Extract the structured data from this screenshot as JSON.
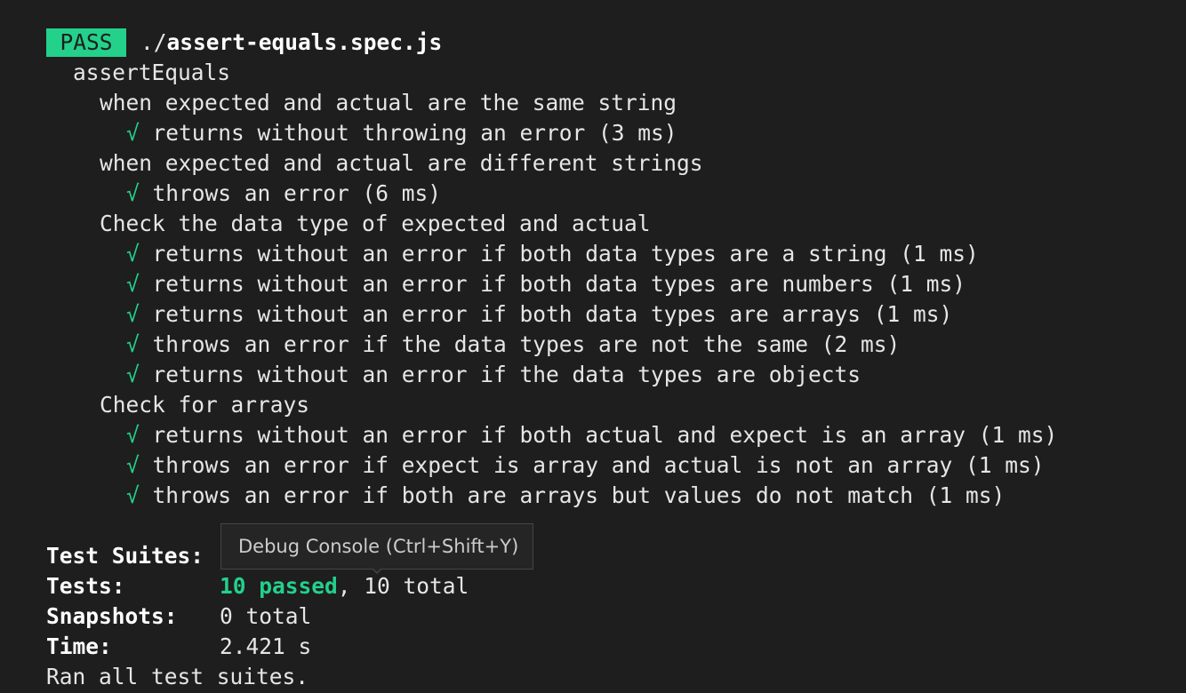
{
  "badge": {
    "label": "PASS"
  },
  "file": {
    "prefix": "./",
    "name": "assert-equals.spec.js"
  },
  "suite": {
    "name": "assertEquals"
  },
  "groups": [
    {
      "title": "when expected and actual are the same string",
      "tests": [
        {
          "check": "√",
          "text": "returns without throwing an error (3 ms)"
        }
      ]
    },
    {
      "title": "when expected and actual are different strings",
      "tests": [
        {
          "check": "√",
          "text": "throws an error (6 ms)"
        }
      ]
    },
    {
      "title": "Check the data type of expected and actual",
      "tests": [
        {
          "check": "√",
          "text": "returns without an error if both data types are a string (1 ms)"
        },
        {
          "check": "√",
          "text": "returns without an error if both data types are numbers (1 ms)"
        },
        {
          "check": "√",
          "text": "returns without an error if both data types are arrays (1 ms)"
        },
        {
          "check": "√",
          "text": "throws an error if the data types are not the same (2 ms)"
        },
        {
          "check": "√",
          "text": "returns without an error if the data types are objects"
        }
      ]
    },
    {
      "title": "Check for arrays",
      "tests": [
        {
          "check": "√",
          "text": "returns without an error if both actual and expect is an array (1 ms)"
        },
        {
          "check": "√",
          "text": "throws an error if expect is array and actual is not an array (1 ms)"
        },
        {
          "check": "√",
          "text": "throws an error if both are arrays but values do not match (1 ms)"
        }
      ]
    }
  ],
  "summary": {
    "suites_label": "Test Suites:",
    "tests_label": "Tests:",
    "tests_passed": "10 passed",
    "tests_sep": ",",
    "tests_total": "10 total",
    "snapshots_label": "Snapshots:",
    "snapshots_value": "0 total",
    "time_label": "Time:",
    "time_value": "2.421 s",
    "footer": "Ran all test suites."
  },
  "tooltip": {
    "text": "Debug Console (Ctrl+Shift+Y)"
  },
  "colors": {
    "background": "#1e1e1e",
    "pass_green": "#23d18b",
    "text": "#e6e6e6",
    "tooltip_bg": "#252526",
    "tooltip_border": "#454545"
  }
}
